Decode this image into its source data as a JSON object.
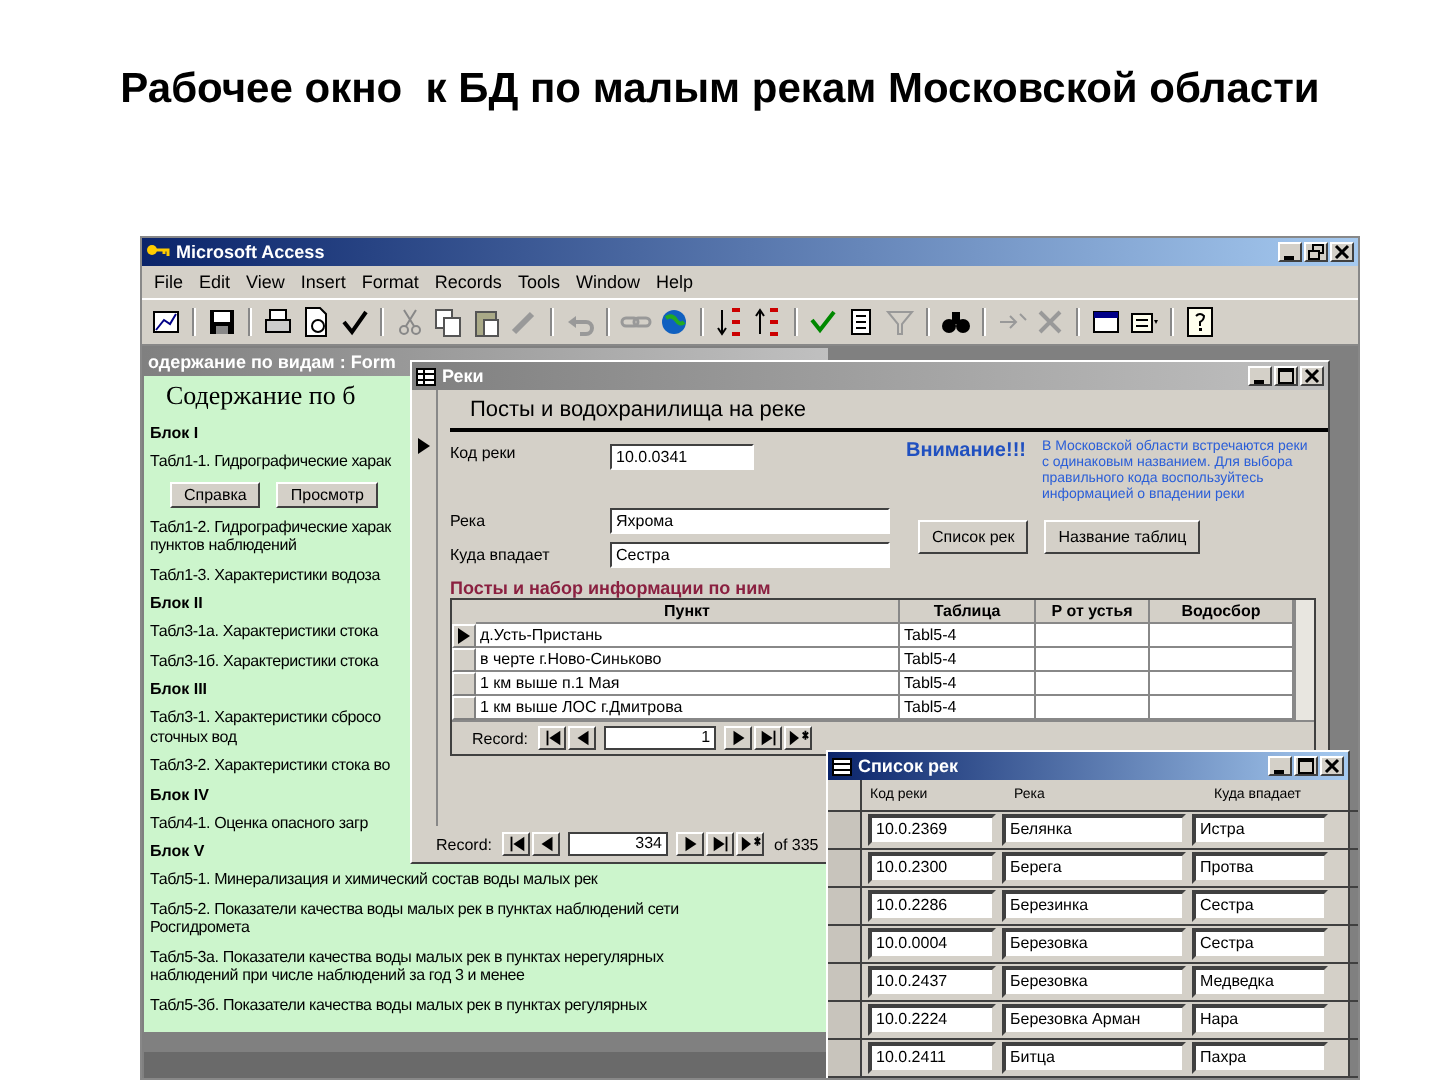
{
  "slide_title": "Рабочее окно  к БД по малым рекам Московской области",
  "app": {
    "title": "Microsoft Access",
    "menu": [
      "File",
      "Edit",
      "View",
      "Insert",
      "Format",
      "Records",
      "Tools",
      "Window",
      "Help"
    ]
  },
  "contents_form": {
    "title": "одержание по видам : Form",
    "heading": "Содержание по б",
    "items": [
      {
        "kind": "block",
        "text": "Блок I"
      },
      {
        "kind": "item",
        "lines": [
          "Табл1-1. Гидрографические харак"
        ]
      },
      {
        "kind": "buttons",
        "buttons": [
          "Справка",
          "Просмотр"
        ]
      },
      {
        "kind": "item",
        "lines": [
          "Табл1-2. Гидрографические харак",
          "пунктов наблюдений"
        ]
      },
      {
        "kind": "item",
        "lines": [
          "Табл1-3. Характеристики водоза"
        ]
      },
      {
        "kind": "block",
        "text": "Блок II"
      },
      {
        "kind": "item",
        "lines": [
          "Табл3-1а. Характеристики стока"
        ]
      },
      {
        "kind": "item",
        "lines": [
          "Табл3-1б. Характеристики стока"
        ]
      },
      {
        "kind": "block",
        "text": "Блок III"
      },
      {
        "kind": "item",
        "lines": [
          "Табл3-1. Характеристики сбросо",
          "сточных вод"
        ]
      },
      {
        "kind": "item",
        "lines": [
          "Табл3-2. Характеристики стока во"
        ]
      },
      {
        "kind": "block",
        "text": "Блок IV"
      },
      {
        "kind": "item",
        "lines": [
          "Табл4-1. Оценка опасного загр"
        ]
      },
      {
        "kind": "block",
        "text": "Блок V"
      },
      {
        "kind": "item",
        "lines": [
          "Табл5-1. Минерализация и химический состав воды малых рек"
        ]
      },
      {
        "kind": "item",
        "lines": [
          "Табл5-2. Показатели качества воды малых рек в пунктах наблюдений сети",
          "Росгидромета"
        ]
      },
      {
        "kind": "item",
        "lines": [
          "Табл5-3а. Показатели качества воды малых рек в пунктах нерегулярных",
          "наблюдений при числе наблюдений за год 3 и менее"
        ]
      },
      {
        "kind": "item",
        "lines": [
          "Табл5-3б. Показатели качества воды малых рек в пунктах регулярных"
        ]
      }
    ]
  },
  "rivers_form": {
    "title": "Реки",
    "heading": "Посты и водохранилища на реке",
    "fields": [
      {
        "label": "Код реки",
        "value": "10.0.0341"
      },
      {
        "label": "Река",
        "value": "Яхрома"
      },
      {
        "label": "Куда впадает",
        "value": "Сестра"
      }
    ],
    "warning": "Внимание!!!",
    "note": "В Московской области встречаются реки с одинаковым названием. Для выбора правильного кода воспользуйтесь информацией о впадении реки",
    "buttons": [
      "Список рек",
      "Название таблиц"
    ],
    "section": "Посты и набор информации по ним",
    "table": {
      "columns": [
        "Пункт",
        "Таблица",
        "Р от устья",
        "Водосбор"
      ],
      "rows": [
        {
          "cells": [
            "д.Усть-Пристань",
            "Tabl5-4"
          ],
          "selected": true
        },
        {
          "cells": [
            "в черте г.Ново-Синьково",
            "Tabl5-4"
          ],
          "selected": false
        },
        {
          "cells": [
            "1 км выше п.1 Мая",
            "Tabl5-4"
          ],
          "selected": false
        },
        {
          "cells": [
            "1 км выше ЛОС г.Дмитрова",
            "Tabl5-4"
          ],
          "selected": false
        }
      ]
    },
    "sub_nav": {
      "label": "Record:",
      "value": "1"
    },
    "nav": {
      "label": "Record:",
      "value": "334",
      "total": "of 335"
    }
  },
  "river_list": {
    "title": "Список рек",
    "columns": [
      "Код реки",
      "Река",
      "Куда впадает"
    ],
    "rows": [
      [
        "10.0.2369",
        "Белянка",
        "Истра"
      ],
      [
        "10.0.2300",
        "Берега",
        "Протва"
      ],
      [
        "10.0.2286",
        "Березинка",
        "Сестра"
      ],
      [
        "10.0.0004",
        "Березовка",
        "Сестра"
      ],
      [
        "10.0.2437",
        "Березовка",
        "Медведка"
      ],
      [
        "10.0.2224",
        "Березовка Арман",
        "Нара"
      ],
      [
        "10.0.2411",
        "Битца",
        "Пахра"
      ]
    ]
  }
}
